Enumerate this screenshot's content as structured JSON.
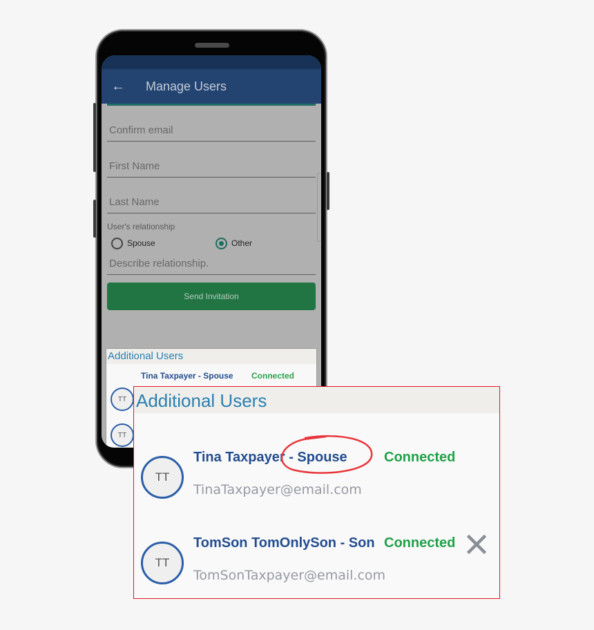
{
  "app": {
    "title": "Manage Users",
    "back_icon": "arrow-left-icon"
  },
  "form": {
    "confirm_email_placeholder": "Confirm email",
    "first_name_placeholder": "First Name",
    "last_name_placeholder": "Last Name",
    "relationship_label": "User's relationship",
    "relationship_options": [
      {
        "label": "Spouse",
        "selected": false
      },
      {
        "label": "Other",
        "selected": true
      }
    ],
    "describe_placeholder": "Describe relationship.",
    "send_button": "Send Invitation"
  },
  "additional_users": {
    "heading": "Additional Users",
    "users": [
      {
        "initials": "TT",
        "name": "Tina Taxpayer - Spouse",
        "status": "Connected",
        "email": "TinaTaxpayer@email.com",
        "removable": false
      },
      {
        "initials": "TT",
        "name": "TomSon TomOnlySon - Son",
        "status": "Connected",
        "email": "TomSonTaxpayer@email.com",
        "removable": true
      }
    ]
  },
  "colors": {
    "app_bar": "#234371",
    "accent_teal": "#1c6e5e",
    "send_button": "#217543",
    "connected": "#21a04a",
    "name": "#234d8f",
    "heading": "#2b7fb1",
    "callout_border": "#e0171f",
    "annotation": "#e8353b"
  }
}
